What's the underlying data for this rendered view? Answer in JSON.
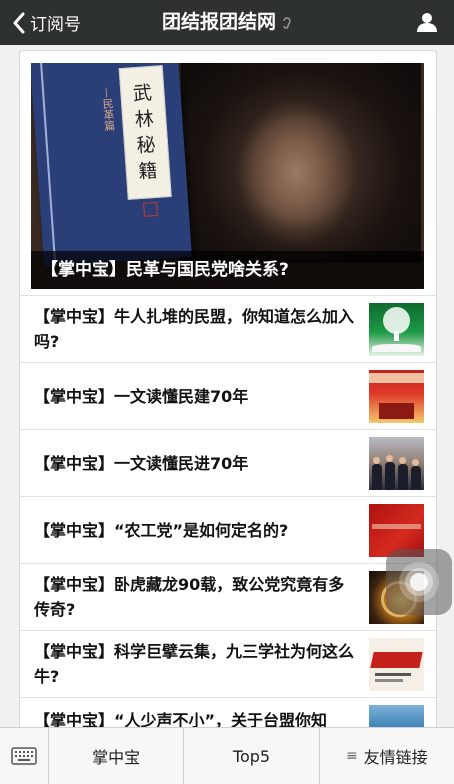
{
  "nav": {
    "back_label": "订阅号",
    "title": "团结报团结网"
  },
  "hero": {
    "caption": "【掌中宝】民革与国民党啥关系?",
    "book_title_chars": [
      "武",
      "林",
      "秘",
      "籍"
    ],
    "book_side_text": "—民革篇"
  },
  "articles": [
    {
      "title": "【掌中宝】牛人扎堆的民盟，你知道怎么加入吗?",
      "thumb": "t1"
    },
    {
      "title": "【掌中宝】一文读懂民建70年",
      "thumb": "t2"
    },
    {
      "title": "【掌中宝】一文读懂民进70年",
      "thumb": "t3"
    },
    {
      "title": "【掌中宝】“农工党”是如何定名的?",
      "thumb": "t4"
    },
    {
      "title": "【掌中宝】卧虎藏龙90载，致公党究竟有多传奇?",
      "thumb": "t5"
    },
    {
      "title": "【掌中宝】科学巨擘云集，九三学社为何这么牛?",
      "thumb": "t6"
    },
    {
      "title": "【掌中宝】“人少声不小”，关于台盟你知",
      "thumb": "t7"
    }
  ],
  "bottom_menu": {
    "tab1": "掌中宝",
    "tab2": "Top5",
    "tab3": "友情链接"
  },
  "colors": {
    "nav_bg": "#2e3132",
    "page_bg": "#f1f1f1"
  }
}
